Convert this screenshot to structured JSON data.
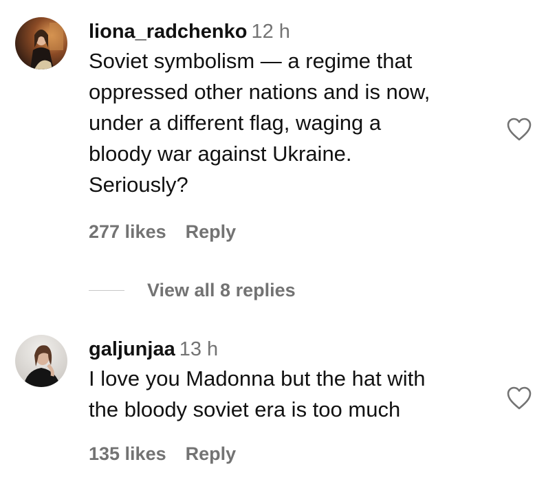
{
  "comments": [
    {
      "username": "liona_radchenko",
      "time": "12 h",
      "lines": [
        "Soviet symbolism — a regime that",
        "oppressed other nations and is now,",
        "under a different flag, waging a",
        "bloody war against Ukraine.",
        "Seriously?"
      ],
      "likes": "277 likes",
      "reply_label": "Reply",
      "view_replies": "View all 8 replies"
    },
    {
      "username": "galjunjaa",
      "time": "13 h",
      "lines": [
        "I love you Madonna but the hat with",
        "the bloody soviet era is too much"
      ],
      "likes": "135 likes",
      "reply_label": "Reply"
    }
  ],
  "icons": {
    "heart": "heart-outline-icon",
    "avatar": "avatar"
  },
  "colors": {
    "text": "#111111",
    "secondary": "#737373",
    "divider": "#c7c7c7"
  }
}
